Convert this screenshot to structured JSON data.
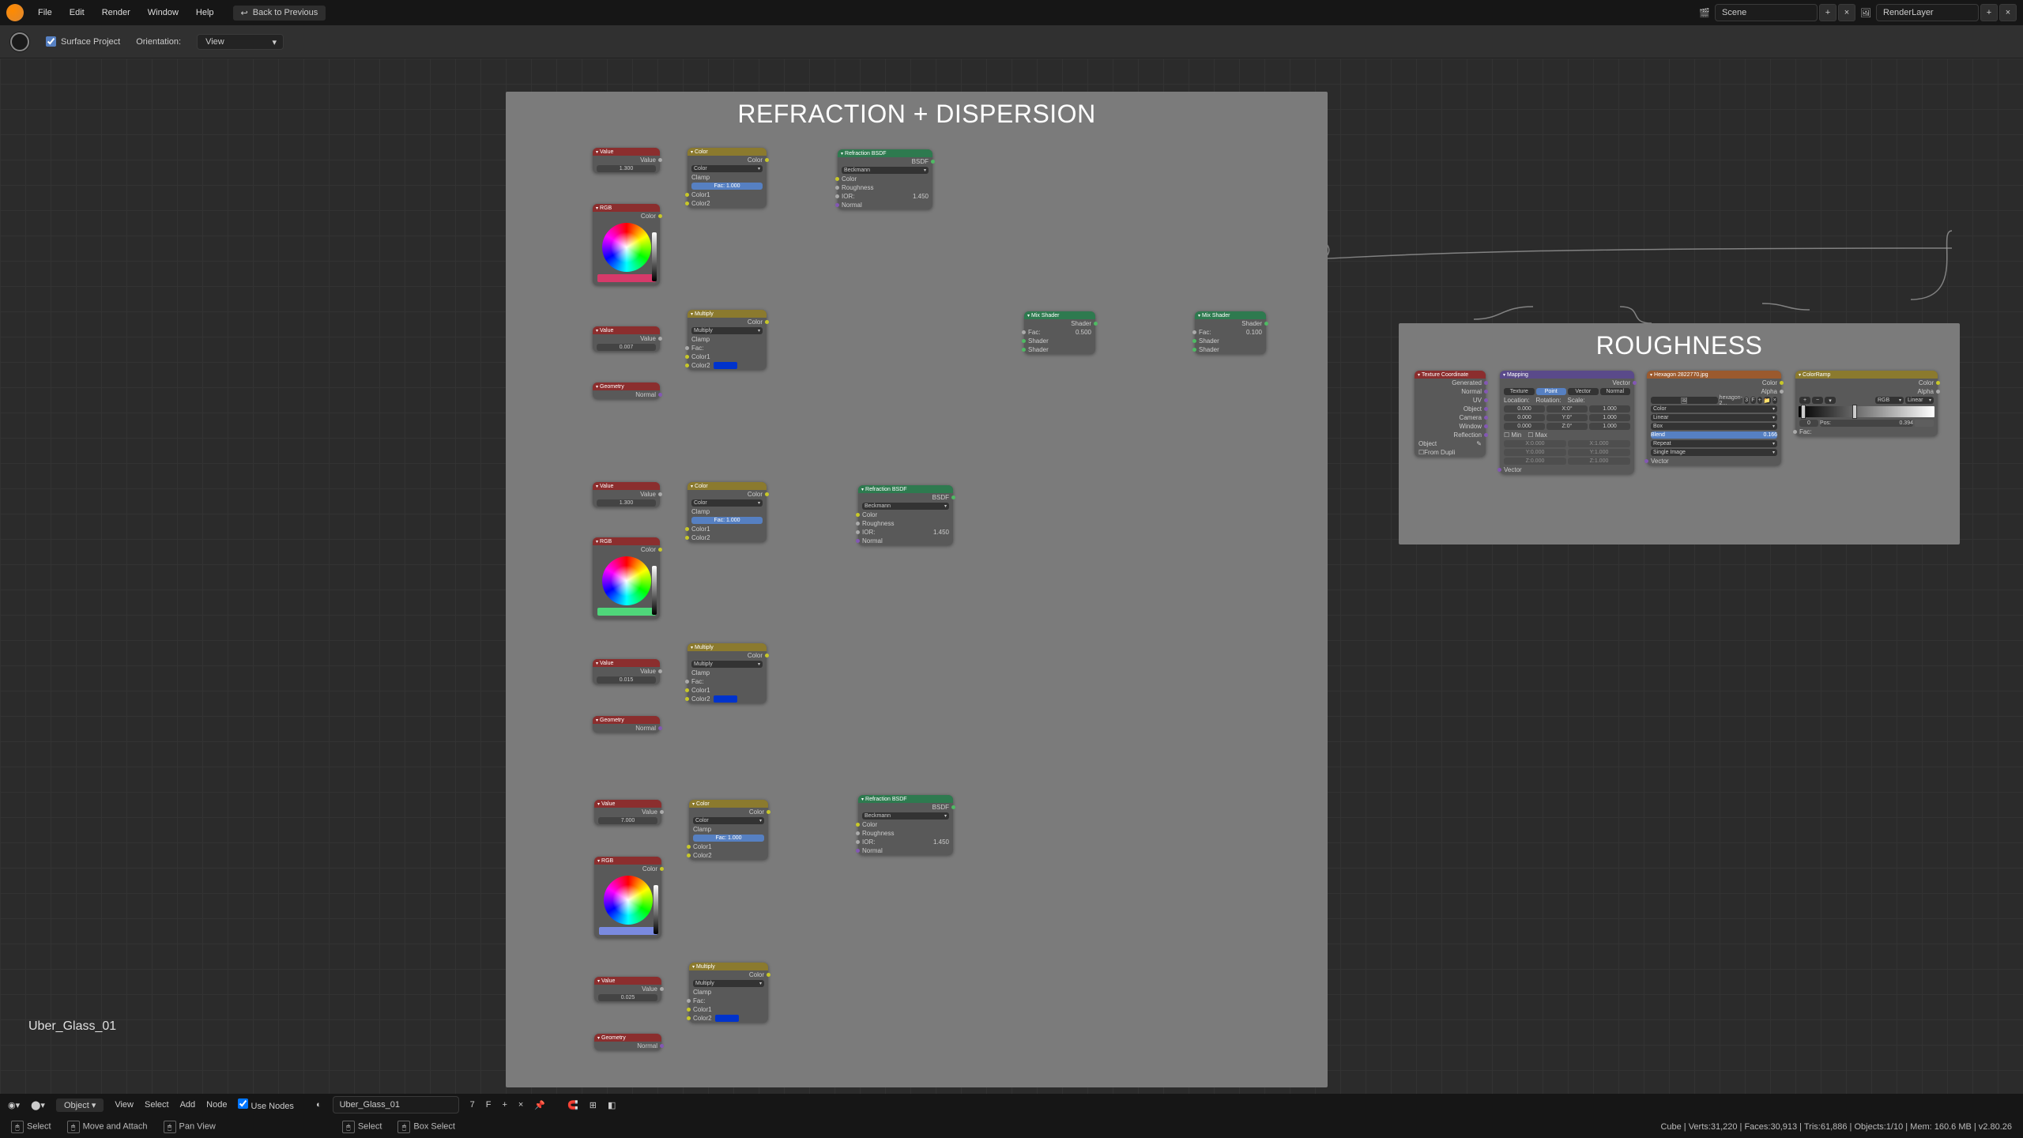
{
  "menu": {
    "file": "File",
    "edit": "Edit",
    "render": "Render",
    "window": "Window",
    "help": "Help",
    "back": "Back to Previous"
  },
  "top": {
    "scene": "Scene",
    "renderlayer": "RenderLayer"
  },
  "toolhdr": {
    "surface_project": "Surface Project",
    "orientation": "Orientation:",
    "orientation_value": "View"
  },
  "frame1": {
    "title": "REFRACTION + DISPERSION"
  },
  "frame2": {
    "title": "ROUGHNESS"
  },
  "labels": {
    "value": "Value",
    "rgb": "RGB",
    "geometry": "Geometry",
    "color": "Color",
    "multiply": "Multiply",
    "clamp": "Clamp",
    "fac": "Fac:",
    "color1": "Color1",
    "color2": "Color2",
    "normal": "Normal",
    "refraction": "Refraction BSDF",
    "bsdf": "BSDF",
    "beckmann": "Beckmann",
    "roughness": "Roughness",
    "ior": "IOR:",
    "mixshader": "Mix Shader",
    "shader": "Shader",
    "texcoord": "Texture Coordinate",
    "generated": "Generated",
    "uv": "UV",
    "object": "Object",
    "camera": "Camera",
    "window": "Window",
    "reflection": "Reflection",
    "from_dupli": "From Dupli",
    "mapping": "Mapping",
    "vector": "Vector",
    "texture": "Texture",
    "point": "Point",
    "location": "Location:",
    "rotation": "Rotation:",
    "scale": "Scale:",
    "min": "Min",
    "max": "Max",
    "image": "Image",
    "alpha": "Alpha",
    "flat": "Linear",
    "repeat": "Repeat",
    "single_image": "Single Image",
    "colorramp": "ColorRamp",
    "rgb_mode": "RGB",
    "linear": "Linear",
    "pos": "Pos:",
    "blend": "Blend",
    "box": "Box",
    "x": "X:",
    "y": "Y:",
    "z": "Z:"
  },
  "vals": {
    "v1": "1.300",
    "v2": "0.007",
    "v3": "1.300",
    "v4": "0.015",
    "v5": "7.000",
    "v6": "0.025",
    "f1": "1.000",
    "f2": "1.000",
    "f3": "1.000",
    "ior1": "1.450",
    "ior2": "1.450",
    "ior3": "1.450",
    "mix1": "0.500",
    "mix2": "0.100",
    "loc": "0.000",
    "rot0": "0°",
    "scl": "1.000",
    "min0": "0.000",
    "max1": "1.000",
    "imgname": "hexagon-2...",
    "users": "3",
    "blend": "0.166",
    "cr_pos": "0.394",
    "cr_idx": "0"
  },
  "bottom": {
    "mode": "Object",
    "view": "View",
    "select": "Select",
    "add": "Add",
    "node": "Node",
    "use_nodes": "Use Nodes",
    "material": "Uber_Glass_01",
    "users": "7",
    "fake": "F"
  },
  "status": {
    "lmb": "Select",
    "mmb": "Move and Attach",
    "pan": "Pan View",
    "lmb2": "Select",
    "box": "Box Select",
    "stats": "Cube | Verts:31,220 | Faces:30,913 | Tris:61,886 | Objects:1/10 | Mem: 160.6 MB | v2.80.26"
  },
  "overlay": {
    "matname": "Uber_Glass_01"
  }
}
